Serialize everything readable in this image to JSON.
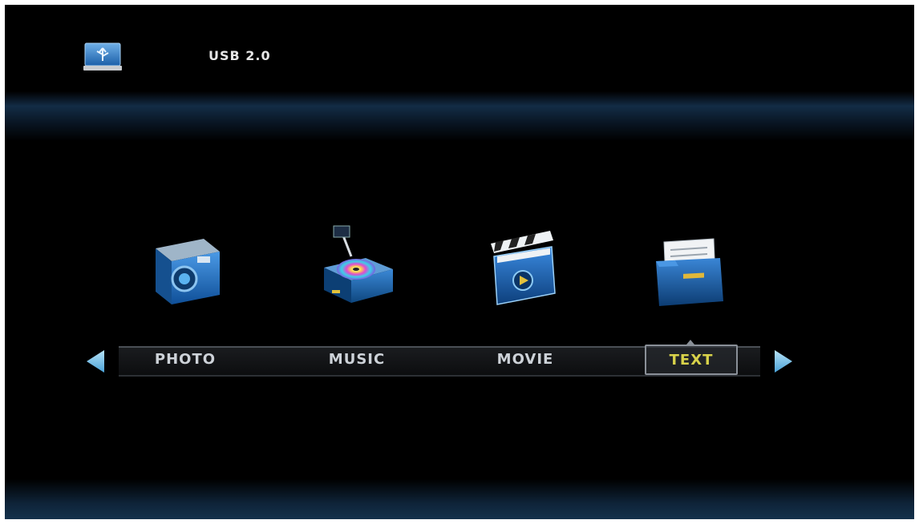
{
  "header": {
    "source_icon": "usb-drive-icon",
    "source_label": "USB 2.0"
  },
  "menu": {
    "selected": "TEXT",
    "items": [
      {
        "label": "PHOTO",
        "icon": "camera-icon"
      },
      {
        "label": "MUSIC",
        "icon": "music-disc-icon"
      },
      {
        "label": "MOVIE",
        "icon": "clapperboard-icon"
      },
      {
        "label": "TEXT",
        "icon": "folder-document-icon"
      }
    ],
    "nav": {
      "left": "arrow-left-icon",
      "right": "arrow-right-icon"
    }
  },
  "colors": {
    "background": "#000000",
    "accent_blue": "#2a73c8",
    "selected_text": "#d8d24a",
    "label_text": "#cdd2d8"
  }
}
